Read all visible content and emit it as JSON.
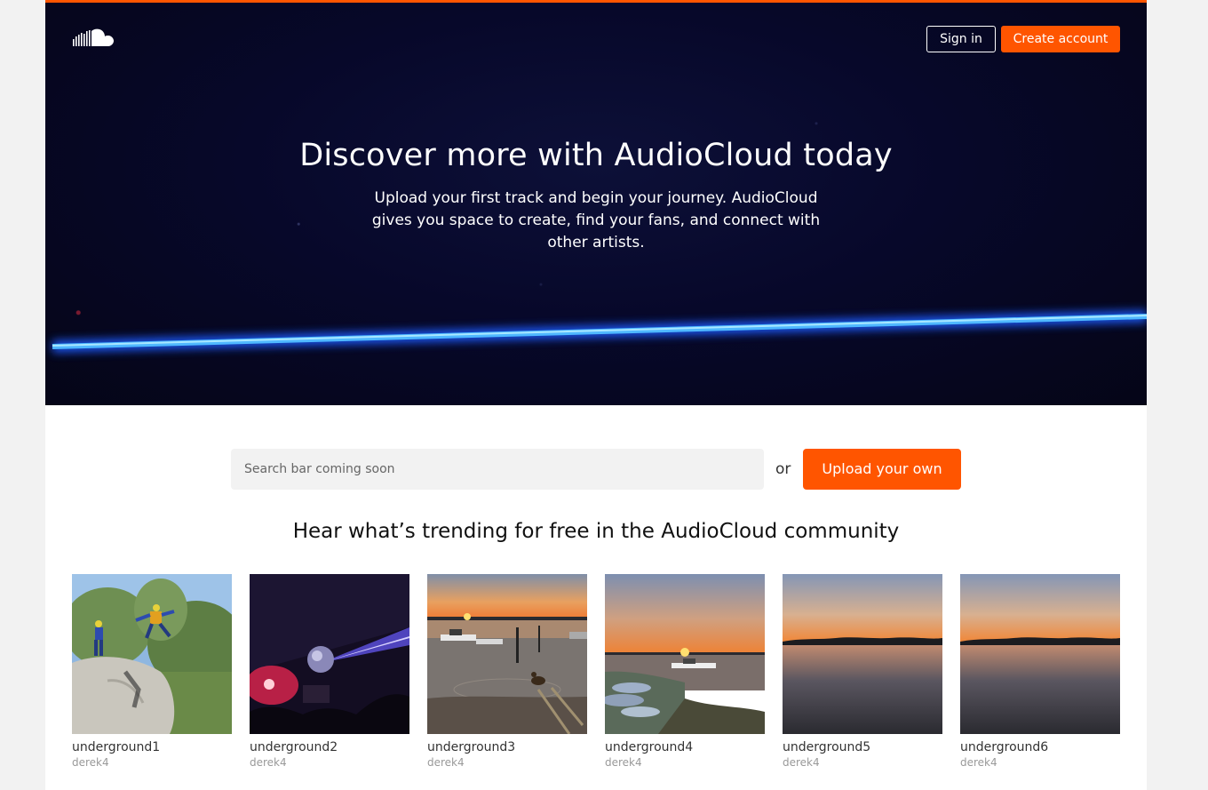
{
  "header": {
    "logo_icon": "soundcloud-cloud-icon",
    "sign_in_label": "Sign in",
    "create_account_label": "Create account"
  },
  "hero": {
    "title": "Discover more with AudioCloud today",
    "subtitle": "Upload your first track and begin your journey. AudioCloud gives you space to create, find your fans, and connect with other artists."
  },
  "search": {
    "placeholder": "Search bar coming soon",
    "or_label": "or",
    "upload_label": "Upload your own"
  },
  "trending": {
    "title": "Hear what’s trending for free in the AudioCloud community",
    "tracks": [
      {
        "title": "underground1",
        "user": "derek4"
      },
      {
        "title": "underground2",
        "user": "derek4"
      },
      {
        "title": "underground3",
        "user": "derek4"
      },
      {
        "title": "underground4",
        "user": "derek4"
      },
      {
        "title": "underground5",
        "user": "derek4"
      },
      {
        "title": "underground6",
        "user": "derek4"
      }
    ]
  },
  "colors": {
    "accent": "#ff5500",
    "hero_background": "#07082a",
    "laser": "#5fd6ff"
  }
}
